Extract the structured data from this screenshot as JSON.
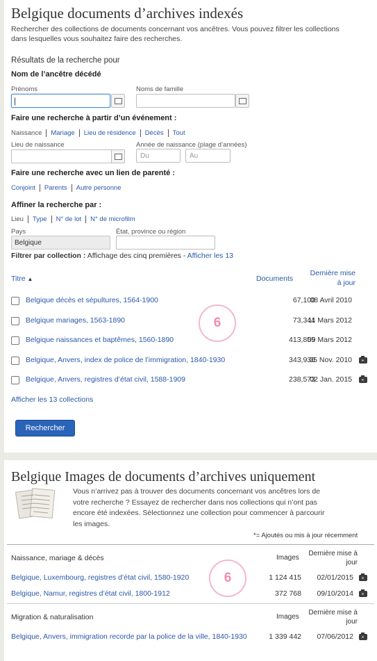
{
  "indexed": {
    "title": "Belgique documents d’archives indexés",
    "intro_line1": "Rechercher des collections de documents concernant vos ancêtres. Vous pouvez filtrer les collections",
    "intro_line2": "dans lesquelles vous souhaitez faire des recherches.",
    "results_for": "Résultats de la recherche pour",
    "deceased_heading": "Nom de l’ancêtre décédé",
    "first_names_label": "Prénoms",
    "first_names_value": "",
    "last_names_label": "Noms de famille",
    "last_names_value": "",
    "event_heading": "Faire une recherche à partir d’un événement :",
    "event_tabs": [
      "Naissance",
      "Mariage",
      "Lieu de résidence",
      "Décès",
      "Tout"
    ],
    "birthplace_label": "Lieu de naissance",
    "birthyear_label": "Année de naissance (plage d’années)",
    "from_placeholder": "Du",
    "to_placeholder": "Au",
    "relation_heading": "Faire une recherche avec un lien de parenté :",
    "relation_tabs": [
      "Conjoint",
      "Parents",
      "Autre personne"
    ],
    "refine_heading": "Affiner la recherche par :",
    "refine_tabs": [
      "Lieu",
      "Type",
      "N° de lot",
      "N° de microfilm"
    ],
    "country_label": "Pays",
    "country_value": "Belgique",
    "state_label": "État, province ou région",
    "state_value": "",
    "filter_bold": "Filtrer par collection :",
    "filter_text": " Affichage des cinq premières - ",
    "filter_link": "Afficher les 13",
    "col_title": "Titre",
    "col_documents": "Documents",
    "col_updated_1": "Dernière mise",
    "col_updated_2": "à jour",
    "rows": [
      {
        "title": "Belgique décès et sépultures, 1564-1900",
        "count": "67,100",
        "date": "08 Avril 2010",
        "camera": false
      },
      {
        "title": "Belgique mariages, 1563-1890",
        "count": "73,344",
        "date": "11 Mars 2012",
        "camera": false
      },
      {
        "title": "Belgique naissances et baptêmes, 1560-1890",
        "count": "413,855",
        "date": "09 Mars 2012",
        "camera": false
      },
      {
        "title": "Belgique, Anvers, index de police de l’immigration, 1840-1930",
        "count": "343,930",
        "date": "05 Nov. 2010",
        "camera": true
      },
      {
        "title": "Belgique, Anvers, registres d’état civil, 1588-1909",
        "count": "238,573",
        "date": "02 Jan. 2015",
        "camera": true
      }
    ],
    "show_all": "Afficher les 13 collections",
    "search_button": "Rechercher",
    "badge": "6"
  },
  "images": {
    "title": "Belgique Images de documents d’archives uniquement",
    "text_lines": [
      "Vous n’arrivez pas à trouver des documents concernant vos ancêtres lors de",
      "votre recherche ? Essayez de rechercher dans nos collections qui n’ont pas",
      "encore été indexées. Sélectionnez une collection pour commencer à parcourir",
      "les images."
    ],
    "note": "*= Ajoutés ou mis à jour récemment",
    "badge": "6",
    "groups": [
      {
        "name": "Naissance, mariage & décès",
        "col_images": "Images",
        "col_updated_1": "Dernière mise à",
        "col_updated_2": "jour",
        "rows": [
          {
            "title": "Belgique, Luxembourg, registres d’état civil, 1580-1920",
            "count": "1 124 415",
            "date": "02/01/2015"
          },
          {
            "title": "Belgique, Namur, registres d’état civil, 1800-1912",
            "count": "372 768",
            "date": "09/10/2014"
          }
        ]
      },
      {
        "name": "Migration & naturalisation",
        "col_images": "Images",
        "col_updated_1": "Dernière mise à",
        "col_updated_2": "jour",
        "rows": [
          {
            "title": "Belgique, Anvers, immigration recorde par la police de la ville, 1840-1930",
            "count": "1 339 442",
            "date": "07/06/2012"
          }
        ]
      }
    ]
  }
}
